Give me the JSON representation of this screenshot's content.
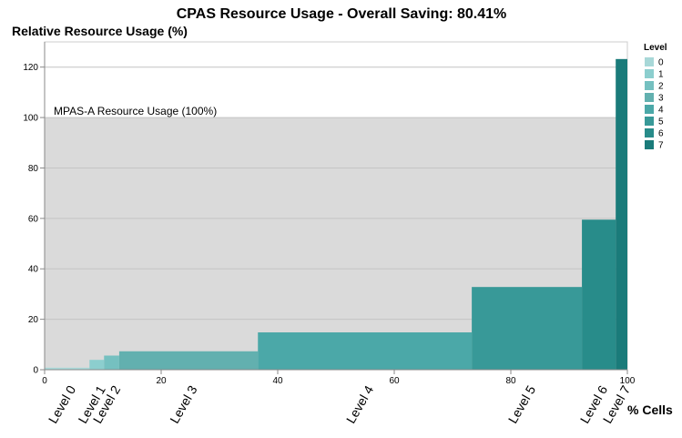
{
  "chart_data": {
    "type": "bar",
    "title": "CPAS Resource Usage - Overall Saving: 80.41%",
    "ylabel": "Relative Resource Usage (%)",
    "xlabel": "% Cells",
    "xlim": [
      0,
      100
    ],
    "ylim": [
      0,
      130
    ],
    "x_ticks": [
      0,
      20,
      40,
      60,
      80,
      100
    ],
    "y_ticks": [
      0,
      20,
      40,
      60,
      80,
      100,
      120
    ],
    "grid": true,
    "legend": {
      "title": "Level",
      "position": "right",
      "labels": [
        "0",
        "1",
        "2",
        "3",
        "4",
        "5",
        "6",
        "7"
      ]
    },
    "reference": {
      "label": "MPAS-A Resource Usage (100%)",
      "value": 100
    },
    "bars": [
      {
        "level": "0",
        "label": "Level 0",
        "x_start": 0,
        "x_end": 7.7,
        "value": 0.8,
        "color": "#a8d8d8"
      },
      {
        "level": "1",
        "label": "Level 1",
        "x_start": 7.7,
        "x_end": 10.2,
        "value": 3.9,
        "color": "#8ccece"
      },
      {
        "level": "2",
        "label": "Level 2",
        "x_start": 10.2,
        "x_end": 12.8,
        "value": 5.6,
        "color": "#75c0c0"
      },
      {
        "level": "3",
        "label": "Level 3",
        "x_start": 12.8,
        "x_end": 36.6,
        "value": 7.3,
        "color": "#62b0af"
      },
      {
        "level": "4",
        "label": "Level 4",
        "x_start": 36.6,
        "x_end": 73.3,
        "value": 14.8,
        "color": "#4ba8a8"
      },
      {
        "level": "5",
        "label": "Level 5",
        "x_start": 73.3,
        "x_end": 92.2,
        "value": 32.8,
        "color": "#389998"
      },
      {
        "level": "6",
        "label": "Level 6",
        "x_start": 92.2,
        "x_end": 98.0,
        "value": 59.5,
        "color": "#288c8a"
      },
      {
        "level": "7",
        "label": "Level 7",
        "x_start": 98.0,
        "x_end": 100,
        "value": 123.2,
        "color": "#1a7b7a"
      }
    ]
  }
}
